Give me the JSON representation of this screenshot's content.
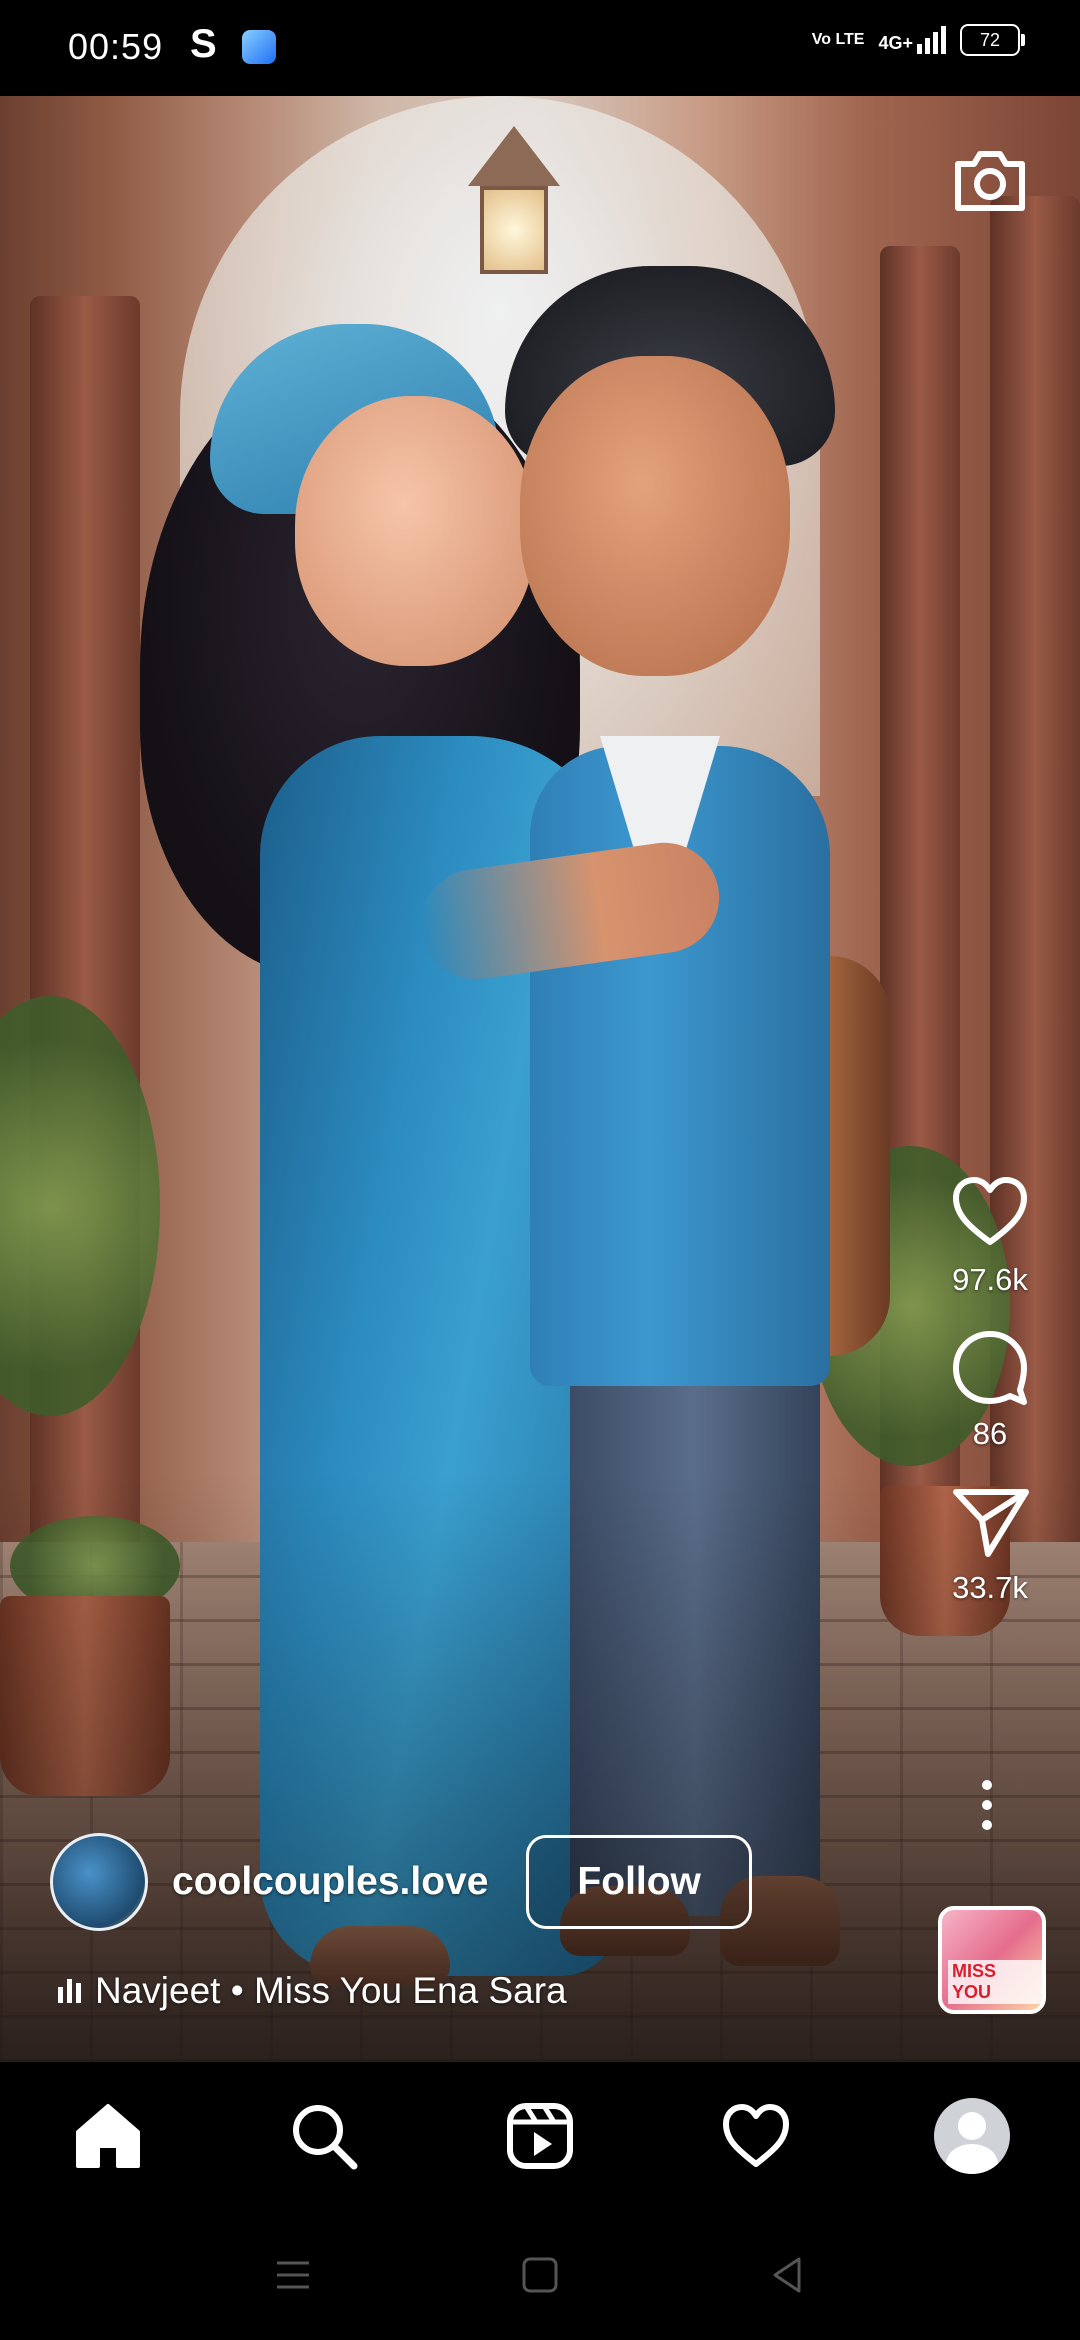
{
  "status_bar": {
    "time": "00:59",
    "s_glyph": "S",
    "network_badge": "Vo LTE",
    "network_type": "4G+",
    "battery": "72"
  },
  "post": {
    "username": "coolcouples.love",
    "follow_label": "Follow",
    "audio": "Navjeet • Miss You Ena Sara",
    "audio_thumb_text": "MISS YOU"
  },
  "actions": {
    "likes": "97.6k",
    "comments": "86",
    "shares": "33.7k"
  },
  "nav": {
    "items": [
      "home-icon",
      "search-icon",
      "reels-icon",
      "activity-heart-icon",
      "profile-avatar"
    ]
  },
  "colors": {
    "background": "#000000",
    "text": "#ffffff"
  }
}
